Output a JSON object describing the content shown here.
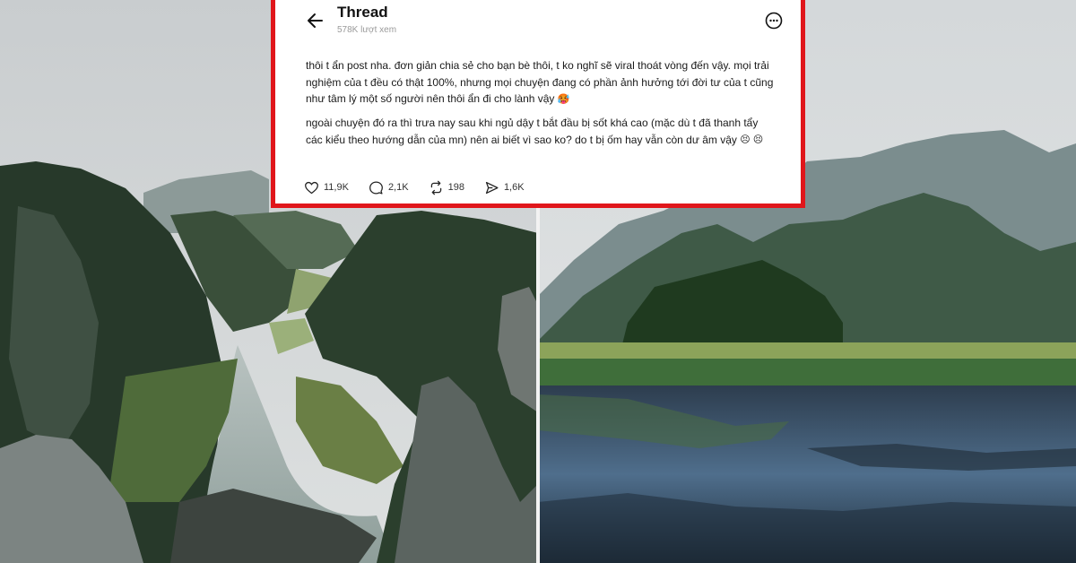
{
  "thread": {
    "title": "Thread",
    "views": "578K lượt xem",
    "paragraph1": "thôi t ẩn post nha. đơn giản chia sẻ cho bạn bè thôi, t ko nghĩ sẽ viral thoát vòng đến vậy. mọi trải nghiệm của t đều có thật 100%, nhưng mọi chuyện đang có phần ảnh hưởng tới đời tư của t cũng như tâm lý một số người nên thôi ẩn đi cho lành vậy",
    "paragraph1_emoji": "🥵",
    "paragraph2": "ngoài chuyện đó ra thì trưa nay sau khi ngủ dậy t bắt đầu bị sốt khá cao (mặc dù t đã thanh tẩy các kiểu theo hướng dẫn của mn) nên ai biết vì sao ko? do t bị ốm hay vẫn còn dư âm vậy",
    "paragraph2_emoji": "😣 😣",
    "likes": "11,9K",
    "comments": "2,1K",
    "reposts": "198",
    "shares": "1,6K"
  },
  "colors": {
    "frame": "#e0161b",
    "text": "#1a1a1a",
    "muted": "#9a9a9a"
  },
  "icons": [
    "back-arrow-icon",
    "more-options-icon",
    "heart-icon",
    "comment-icon",
    "repost-icon",
    "share-icon"
  ]
}
